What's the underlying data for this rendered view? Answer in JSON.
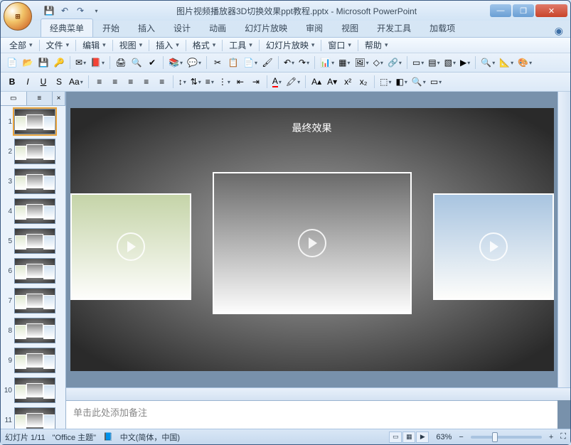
{
  "title": {
    "doc": "图片视频播放器3D切换效果ppt教程.pptx",
    "app": "Microsoft PowerPoint"
  },
  "ribbon": {
    "tabs": [
      "经典菜单",
      "开始",
      "插入",
      "设计",
      "动画",
      "幻灯片放映",
      "审阅",
      "视图",
      "开发工具",
      "加载项"
    ],
    "active": 0
  },
  "menu": {
    "items": [
      "全部",
      "文件",
      "编辑",
      "视图",
      "插入",
      "格式",
      "工具",
      "幻灯片放映",
      "窗口",
      "帮助"
    ]
  },
  "slide": {
    "title": "最终效果"
  },
  "notes": {
    "placeholder": "单击此处添加备注"
  },
  "status": {
    "slide_counter": "幻灯片 1/11",
    "theme": "\"Office 主题\"",
    "lang": "中文(简体，中国)",
    "zoom": "63%"
  },
  "thumbs": {
    "count": 11,
    "selected": 1
  }
}
